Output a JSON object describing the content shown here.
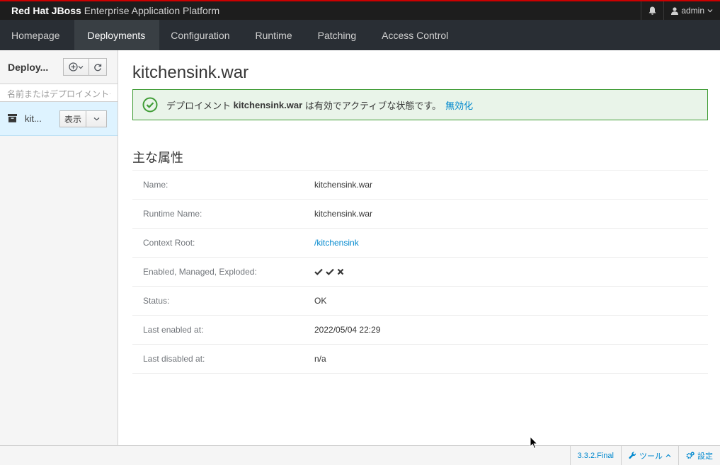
{
  "header": {
    "brand_bold": "Red Hat JBoss",
    "brand_rest": "Enterprise Application Platform",
    "user_label": "admin"
  },
  "nav": {
    "items": [
      {
        "label": "Homepage"
      },
      {
        "label": "Deployments"
      },
      {
        "label": "Configuration"
      },
      {
        "label": "Runtime"
      },
      {
        "label": "Patching"
      },
      {
        "label": "Access Control"
      }
    ],
    "active": "Deployments"
  },
  "sidebar": {
    "title": "Deploy...",
    "filter_placeholder": "名前またはデプロイメントタイプでフィルター",
    "items": [
      {
        "label": "kit...",
        "view_label": "表示"
      }
    ]
  },
  "main": {
    "title": "kitchensink.war",
    "alert": {
      "prefix": "デプロイメント",
      "name": "kitchensink.war",
      "suffix": "は有効でアクティブな状態です。",
      "link": "無効化"
    },
    "section_title": "主な属性",
    "attributes": [
      {
        "key": "Name:",
        "value": "kitchensink.war"
      },
      {
        "key": "Runtime Name:",
        "value": "kitchensink.war"
      },
      {
        "key": "Context Root:",
        "value": "/kitchensink"
      },
      {
        "key": "Enabled, Managed, Exploded:",
        "value": ""
      },
      {
        "key": "Status:",
        "value": "OK"
      },
      {
        "key": "Last enabled at:",
        "value": "2022/05/04 22:29"
      },
      {
        "key": "Last disabled at:",
        "value": "n/a"
      }
    ],
    "flags": {
      "enabled": true,
      "managed": true,
      "exploded": false
    }
  },
  "footer": {
    "version": "3.3.2.Final",
    "tools": "ツール",
    "settings": "設定"
  },
  "colors": {
    "accent_red": "#cc0000",
    "nav_bg": "#292e34",
    "link": "#0088ce",
    "success": "#3f9c35"
  }
}
